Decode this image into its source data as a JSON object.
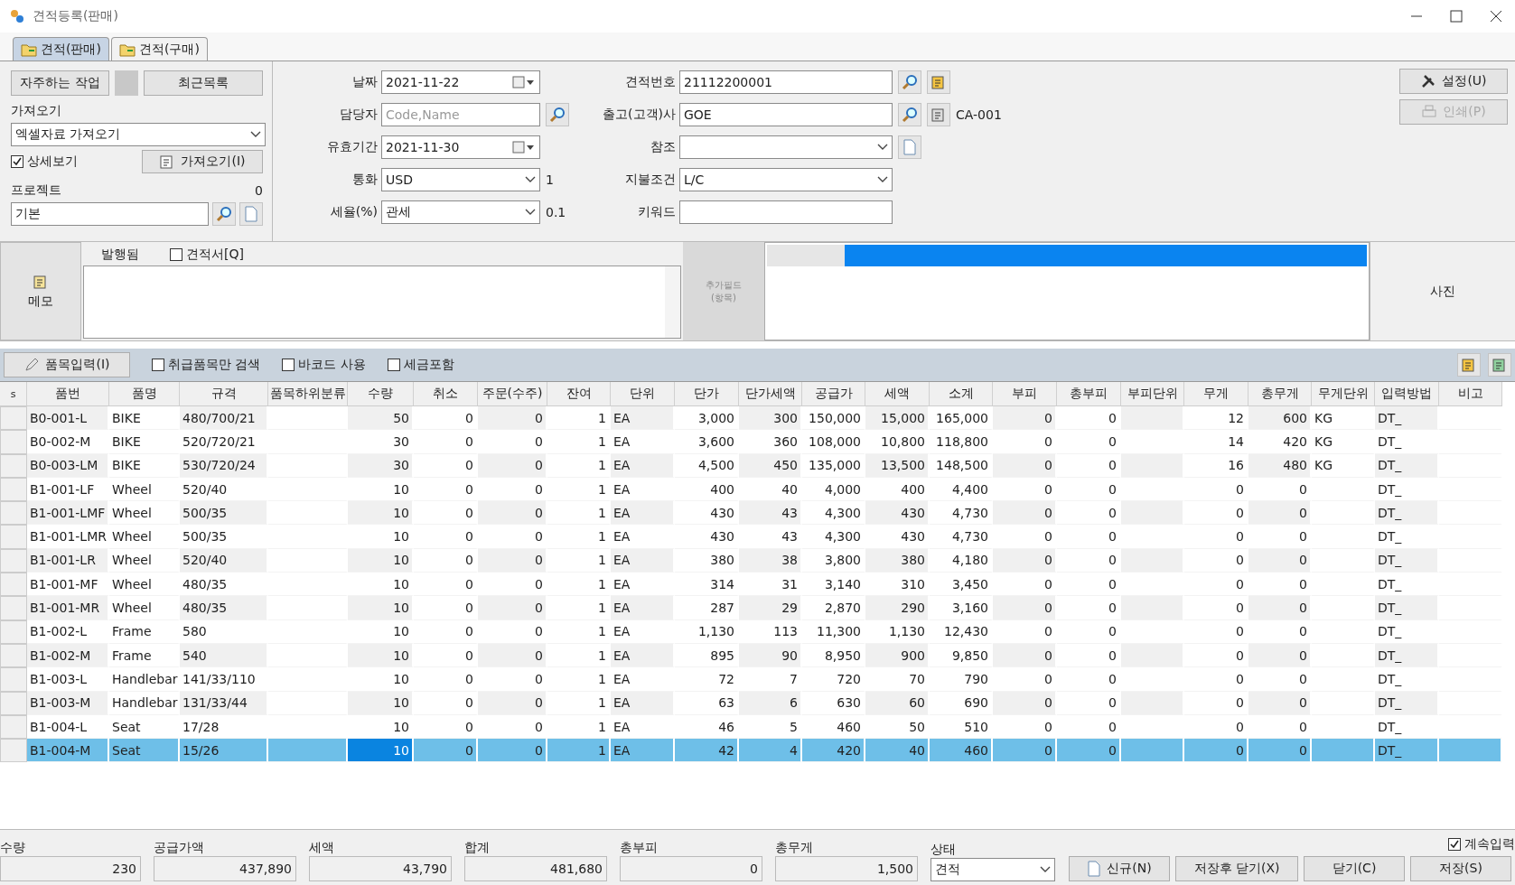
{
  "window": {
    "title": "견적등록(판매)"
  },
  "tabs": [
    {
      "label": "견적(판매)",
      "selected": true
    },
    {
      "label": "견적(구매)",
      "selected": false
    }
  ],
  "left_panel": {
    "frequent_button": "자주하는 작업",
    "recent_button": "최근목록",
    "import_label": "가져오기",
    "import_source": "엑셀자료 가져오기",
    "detail_view": {
      "label": "상세보기",
      "checked": true
    },
    "import_button": "가져오기(I)",
    "project_label": "프로젝트",
    "project_count": "0",
    "project_value": "기본"
  },
  "center_fields": [
    {
      "label": "날짜",
      "kind": "date",
      "value": "2021-11-22"
    },
    {
      "label": "담당자",
      "kind": "search",
      "placeholder": "Code,Name"
    },
    {
      "label": "유효기간",
      "kind": "date",
      "value": "2021-11-30"
    },
    {
      "label": "통화",
      "kind": "select",
      "value": "USD",
      "suffix": "1"
    },
    {
      "label": "세율(%)",
      "kind": "select",
      "value": "관세",
      "suffix": "0.1"
    }
  ],
  "right_fields": [
    {
      "label": "견적번호",
      "kind": "number",
      "value": "21112200001"
    },
    {
      "label": "출고(고객)사",
      "kind": "customer",
      "value": "GOE",
      "suffix": "CA-001"
    },
    {
      "label": "참조",
      "kind": "reference"
    },
    {
      "label": "지불조건",
      "kind": "select",
      "value": "L/C"
    },
    {
      "label": "키워드",
      "kind": "text"
    }
  ],
  "side_buttons": [
    {
      "label": "설정(U)",
      "disabled": false
    },
    {
      "label": "인쇄(P)",
      "disabled": true
    }
  ],
  "memo": {
    "button": "메모",
    "issued_label": "발행됨",
    "quote_check": {
      "label": "견적서[Q]",
      "checked": false
    },
    "extra_fields_button": "추가필드\n(항목)",
    "progress": {
      "level": 0.87
    },
    "photo_label": "사진"
  },
  "item_toolbar": {
    "button": "품목입력(I)",
    "options": [
      {
        "label": "취급품목만 검색",
        "checked": false
      },
      {
        "label": "바코드 사용",
        "checked": false
      },
      {
        "label": "세금포함",
        "checked": false
      }
    ]
  },
  "table": {
    "columns": [
      "s",
      "품번",
      "품명",
      "규격",
      "품목하위분류",
      "수량",
      "취소",
      "주문(수주)",
      "잔여",
      "단위",
      "단가",
      "단가세액",
      "공급가",
      "세액",
      "소계",
      "부피",
      "총부피",
      "부피단위",
      "무게",
      "총무게",
      "무게단위",
      "입력방법",
      "비고"
    ],
    "rows": [
      {
        "selected": false,
        "cells": [
          "",
          "B0-001-L",
          "BIKE",
          "480/700/21",
          "",
          "50",
          "0",
          "0",
          "1",
          "EA",
          "3,000",
          "300",
          "150,000",
          "15,000",
          "165,000",
          "0",
          "0",
          "",
          "12",
          "600",
          "KG",
          "DT_",
          ""
        ]
      },
      {
        "selected": false,
        "cells": [
          "",
          "B0-002-M",
          "BIKE",
          "520/720/21",
          "",
          "30",
          "0",
          "0",
          "1",
          "EA",
          "3,600",
          "360",
          "108,000",
          "10,800",
          "118,800",
          "0",
          "0",
          "",
          "14",
          "420",
          "KG",
          "DT_",
          ""
        ]
      },
      {
        "selected": false,
        "cells": [
          "",
          "B0-003-LM",
          "BIKE",
          "530/720/24",
          "",
          "30",
          "0",
          "0",
          "1",
          "EA",
          "4,500",
          "450",
          "135,000",
          "13,500",
          "148,500",
          "0",
          "0",
          "",
          "16",
          "480",
          "KG",
          "DT_",
          ""
        ]
      },
      {
        "selected": false,
        "cells": [
          "",
          "B1-001-LF",
          "Wheel",
          "520/40",
          "",
          "10",
          "0",
          "0",
          "1",
          "EA",
          "400",
          "40",
          "4,000",
          "400",
          "4,400",
          "0",
          "0",
          "",
          "0",
          "0",
          "",
          "DT_",
          ""
        ]
      },
      {
        "selected": false,
        "cells": [
          "",
          "B1-001-LMF",
          "Wheel",
          "500/35",
          "",
          "10",
          "0",
          "0",
          "1",
          "EA",
          "430",
          "43",
          "4,300",
          "430",
          "4,730",
          "0",
          "0",
          "",
          "0",
          "0",
          "",
          "DT_",
          ""
        ]
      },
      {
        "selected": false,
        "cells": [
          "",
          "B1-001-LMR",
          "Wheel",
          "500/35",
          "",
          "10",
          "0",
          "0",
          "1",
          "EA",
          "430",
          "43",
          "4,300",
          "430",
          "4,730",
          "0",
          "0",
          "",
          "0",
          "0",
          "",
          "DT_",
          ""
        ]
      },
      {
        "selected": false,
        "cells": [
          "",
          "B1-001-LR",
          "Wheel",
          "520/40",
          "",
          "10",
          "0",
          "0",
          "1",
          "EA",
          "380",
          "38",
          "3,800",
          "380",
          "4,180",
          "0",
          "0",
          "",
          "0",
          "0",
          "",
          "DT_",
          ""
        ]
      },
      {
        "selected": false,
        "cells": [
          "",
          "B1-001-MF",
          "Wheel",
          "480/35",
          "",
          "10",
          "0",
          "0",
          "1",
          "EA",
          "314",
          "31",
          "3,140",
          "310",
          "3,450",
          "0",
          "0",
          "",
          "0",
          "0",
          "",
          "DT_",
          ""
        ]
      },
      {
        "selected": false,
        "cells": [
          "",
          "B1-001-MR",
          "Wheel",
          "480/35",
          "",
          "10",
          "0",
          "0",
          "1",
          "EA",
          "287",
          "29",
          "2,870",
          "290",
          "3,160",
          "0",
          "0",
          "",
          "0",
          "0",
          "",
          "DT_",
          ""
        ]
      },
      {
        "selected": false,
        "cells": [
          "",
          "B1-002-L",
          "Frame",
          "580",
          "",
          "10",
          "0",
          "0",
          "1",
          "EA",
          "1,130",
          "113",
          "11,300",
          "1,130",
          "12,430",
          "0",
          "0",
          "",
          "0",
          "0",
          "",
          "DT_",
          ""
        ]
      },
      {
        "selected": false,
        "cells": [
          "",
          "B1-002-M",
          "Frame",
          "540",
          "",
          "10",
          "0",
          "0",
          "1",
          "EA",
          "895",
          "90",
          "8,950",
          "900",
          "9,850",
          "0",
          "0",
          "",
          "0",
          "0",
          "",
          "DT_",
          ""
        ]
      },
      {
        "selected": false,
        "cells": [
          "",
          "B1-003-L",
          "Handlebar",
          "141/33/110",
          "",
          "10",
          "0",
          "0",
          "1",
          "EA",
          "72",
          "7",
          "720",
          "70",
          "790",
          "0",
          "0",
          "",
          "0",
          "0",
          "",
          "DT_",
          ""
        ]
      },
      {
        "selected": false,
        "cells": [
          "",
          "B1-003-M",
          "Handlebar",
          "131/33/44",
          "",
          "10",
          "0",
          "0",
          "1",
          "EA",
          "63",
          "6",
          "630",
          "60",
          "690",
          "0",
          "0",
          "",
          "0",
          "0",
          "",
          "DT_",
          ""
        ]
      },
      {
        "selected": false,
        "cells": [
          "",
          "B1-004-L",
          "Seat",
          "17/28",
          "",
          "10",
          "0",
          "0",
          "1",
          "EA",
          "46",
          "5",
          "460",
          "50",
          "510",
          "0",
          "0",
          "",
          "0",
          "0",
          "",
          "DT_",
          ""
        ]
      },
      {
        "selected": true,
        "cells": [
          "",
          "B1-004-M",
          "Seat",
          "15/26",
          "",
          "10",
          "0",
          "0",
          "1",
          "EA",
          "42",
          "4",
          "420",
          "40",
          "460",
          "0",
          "0",
          "",
          "0",
          "0",
          "",
          "DT_",
          ""
        ]
      }
    ]
  },
  "totals": [
    {
      "label": "수량",
      "value": "230"
    },
    {
      "label": "공급가액",
      "value": "437,890"
    },
    {
      "label": "세액",
      "value": "43,790"
    },
    {
      "label": "합계",
      "value": "481,680"
    },
    {
      "label": "총부피",
      "value": "0"
    },
    {
      "label": "총무게",
      "value": "1,500"
    }
  ],
  "status": {
    "label": "상태",
    "value": "견적"
  },
  "continue_input": {
    "label": "계속입력",
    "checked": true
  },
  "footer_buttons": [
    {
      "label": "신규(N)",
      "kind": "new"
    },
    {
      "label": "저장후 닫기(X)",
      "kind": "plain"
    },
    {
      "label": "닫기(C)",
      "kind": "plain"
    },
    {
      "label": "저장(S)",
      "kind": "plain"
    }
  ]
}
